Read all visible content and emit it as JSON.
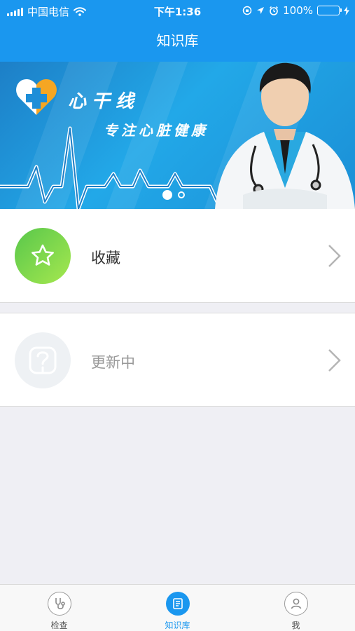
{
  "status_bar": {
    "carrier": "中国电信",
    "time": "下午1:36",
    "battery": "100%"
  },
  "header": {
    "title": "知识库"
  },
  "banner": {
    "title": "心干线",
    "subtitle": "专注心脏健康",
    "page_indicator": {
      "current": 1,
      "total": 2
    }
  },
  "list": [
    {
      "label": "收藏",
      "icon": "star-icon"
    },
    {
      "label": "更新中",
      "icon": "updating-icon"
    }
  ],
  "tabbar": {
    "active": 1,
    "tabs": [
      {
        "label": "检查",
        "icon": "stethoscope-icon"
      },
      {
        "label": "知识库",
        "icon": "knowledge-book-icon"
      },
      {
        "label": "我",
        "icon": "person-icon"
      }
    ]
  },
  "colors": {
    "primary": "#1a97ef",
    "favorite_green": "#6cd44a",
    "background": "#efeff4"
  }
}
